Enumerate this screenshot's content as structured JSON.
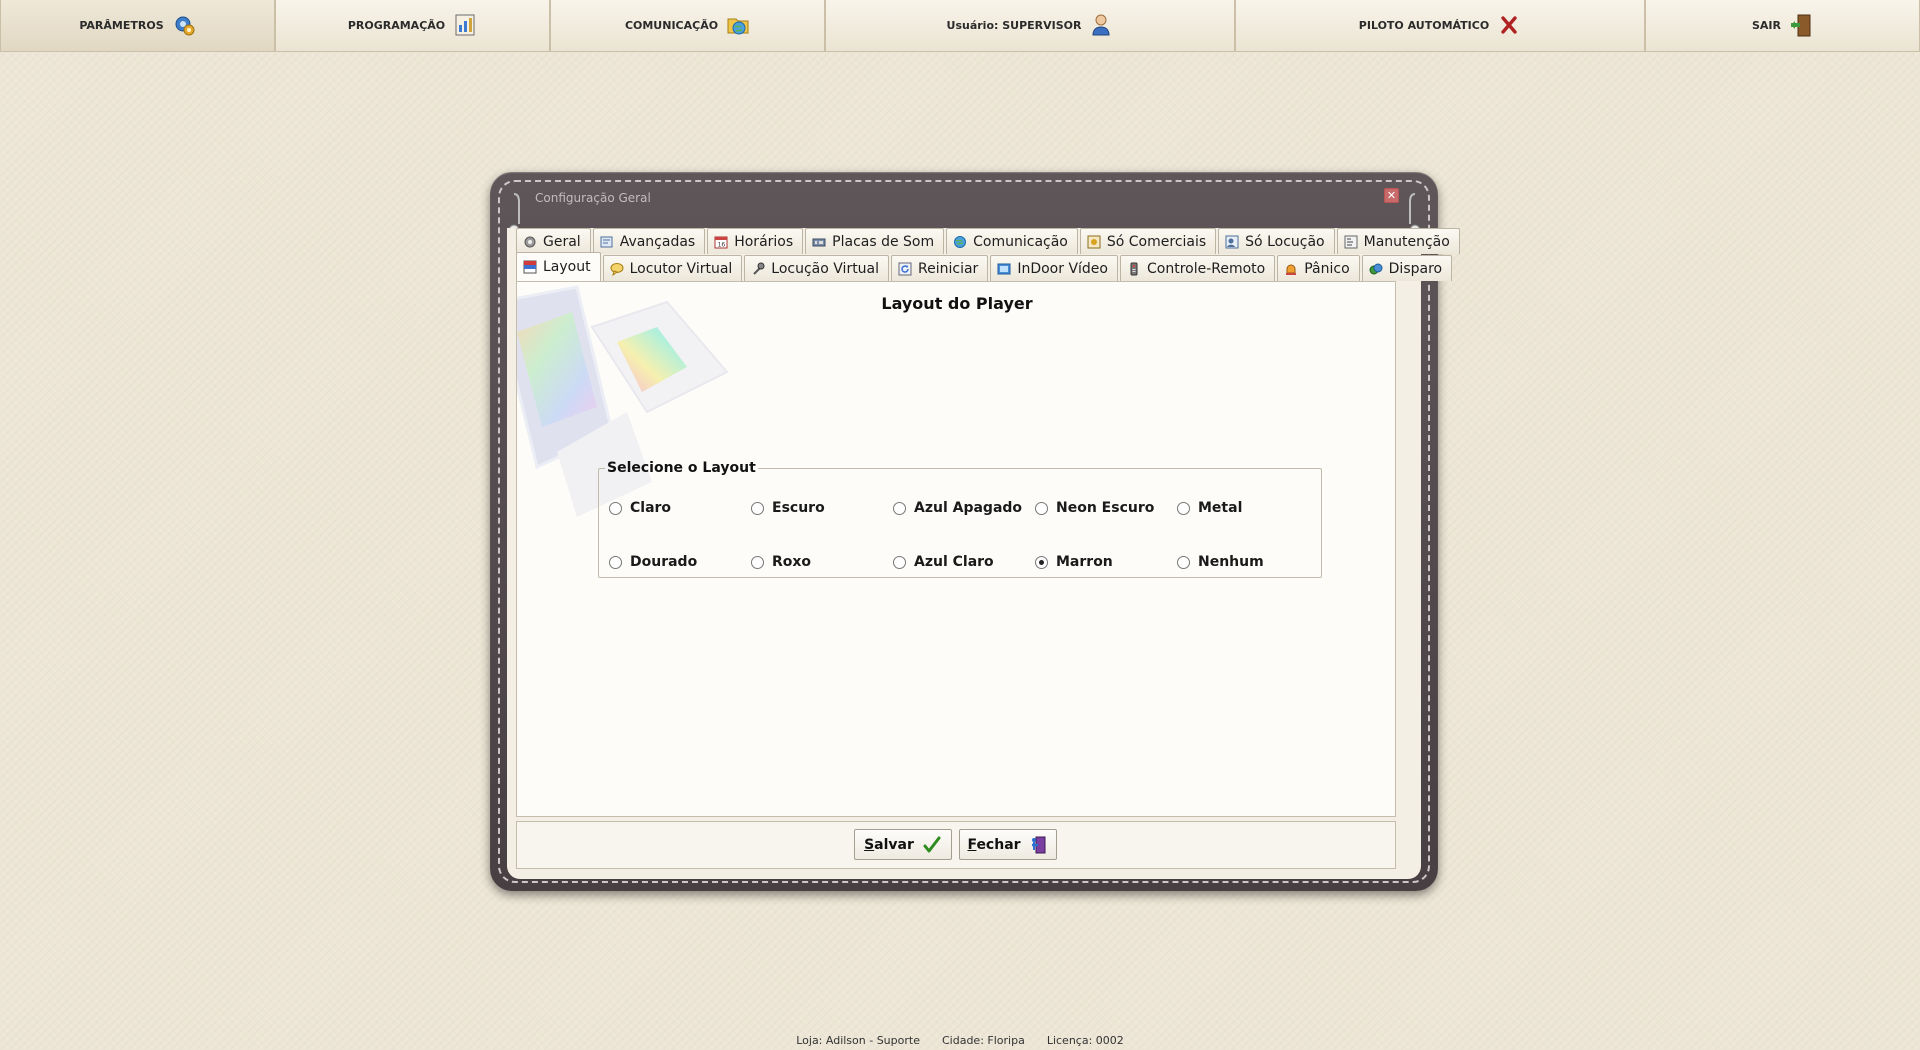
{
  "topbar": {
    "items": [
      {
        "label": "PARÂMETROS",
        "icon": "gear-icon"
      },
      {
        "label": "PROGRAMAÇÃO",
        "icon": "music-chart-icon"
      },
      {
        "label": "COMUNICAÇÃO",
        "icon": "globe-folder-icon"
      },
      {
        "label": "Usuário: SUPERVISOR",
        "icon": "user-icon"
      },
      {
        "label": "PILOTO AUTOMÁTICO",
        "icon": "red-x-icon"
      },
      {
        "label": "SAIR",
        "icon": "exit-door-icon"
      }
    ]
  },
  "dialog": {
    "title": "Configuração Geral",
    "close_label": "✕",
    "tabs_row1": [
      {
        "label": "Geral",
        "icon": "gear-icon"
      },
      {
        "label": "Avançadas",
        "icon": "settings-doc-icon"
      },
      {
        "label": "Horários",
        "icon": "calendar-icon"
      },
      {
        "label": "Placas de Som",
        "icon": "sound-card-icon"
      },
      {
        "label": "Comunicação",
        "icon": "globe-icon"
      },
      {
        "label": "Só Comerciais",
        "icon": "commercial-icon"
      },
      {
        "label": "Só Locução",
        "icon": "voice-icon"
      },
      {
        "label": "Manutenção",
        "icon": "maintenance-icon"
      }
    ],
    "tabs_row2": [
      {
        "label": "Layout",
        "icon": "layout-icon"
      },
      {
        "label": "Locutor Virtual",
        "icon": "speech-bubble-icon"
      },
      {
        "label": "Locução Virtual",
        "icon": "microphone-icon"
      },
      {
        "label": "Reiniciar",
        "icon": "restart-icon"
      },
      {
        "label": "InDoor Vídeo",
        "icon": "video-icon"
      },
      {
        "label": "Controle-Remoto",
        "icon": "remote-icon"
      },
      {
        "label": "Pânico",
        "icon": "alarm-bell-icon"
      },
      {
        "label": "Disparo",
        "icon": "trigger-icon"
      }
    ],
    "active_tab": "Layout",
    "page_title": "Layout do Player",
    "group_legend": "Selecione o Layout",
    "options": [
      {
        "label": "Claro",
        "selected": false
      },
      {
        "label": "Escuro",
        "selected": false
      },
      {
        "label": "Azul Apagado",
        "selected": false
      },
      {
        "label": "Neon Escuro",
        "selected": false
      },
      {
        "label": "Metal",
        "selected": false
      },
      {
        "label": "Dourado",
        "selected": false
      },
      {
        "label": "Roxo",
        "selected": false
      },
      {
        "label": "Azul Claro",
        "selected": false
      },
      {
        "label": "Marron",
        "selected": true
      },
      {
        "label": "Nenhum",
        "selected": false
      }
    ],
    "buttons": {
      "save": {
        "first": "S",
        "rest": "alvar",
        "icon": "green-check-icon"
      },
      "close": {
        "first": "F",
        "rest": "echar",
        "icon": "exit-icon"
      }
    }
  },
  "status": {
    "loja": "Loja: Adilson - Suporte",
    "cidade": "Cidade: Floripa",
    "licenca": "Licença: 0002"
  },
  "colors": {
    "background": "#ede6d6",
    "frame": "#524a4c",
    "accent_red": "#b02222",
    "accent_green": "#2e8b1e"
  }
}
